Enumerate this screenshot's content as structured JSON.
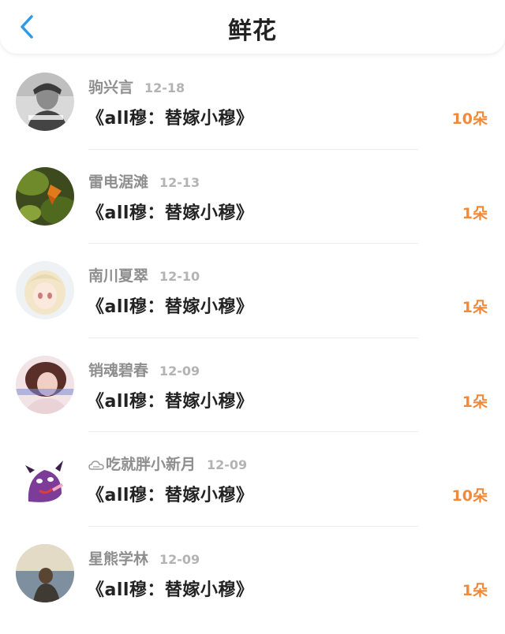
{
  "header": {
    "title": "鲜花",
    "back_icon": "chevron-left-icon",
    "accent_color": "#2f9ae6"
  },
  "items": [
    {
      "username": "驹兴言",
      "date": "12-18",
      "book": "《all穆：替嫁小穆》",
      "count": "10朵"
    },
    {
      "username": "雷电涺滩",
      "date": "12-13",
      "book": "《all穆：替嫁小穆》",
      "count": "1朵"
    },
    {
      "username": "南川夏翠",
      "date": "12-10",
      "book": "《all穆：替嫁小穆》",
      "count": "1朵"
    },
    {
      "username": "销魂碧春",
      "date": "12-09",
      "book": "《all穆：替嫁小穆》",
      "count": "1朵"
    },
    {
      "username": "吃就胖小新月",
      "date": "12-09",
      "book": "《all穆：替嫁小穆》",
      "count": "10朵",
      "name_prefix_icon": "cloud-icon"
    },
    {
      "username": "星熊学林",
      "date": "12-09",
      "book": "《all穆：替嫁小穆》",
      "count": "1朵"
    }
  ],
  "colors": {
    "count": "#f08a3a",
    "username": "#8e8e8e",
    "date": "#b3b3b3"
  }
}
